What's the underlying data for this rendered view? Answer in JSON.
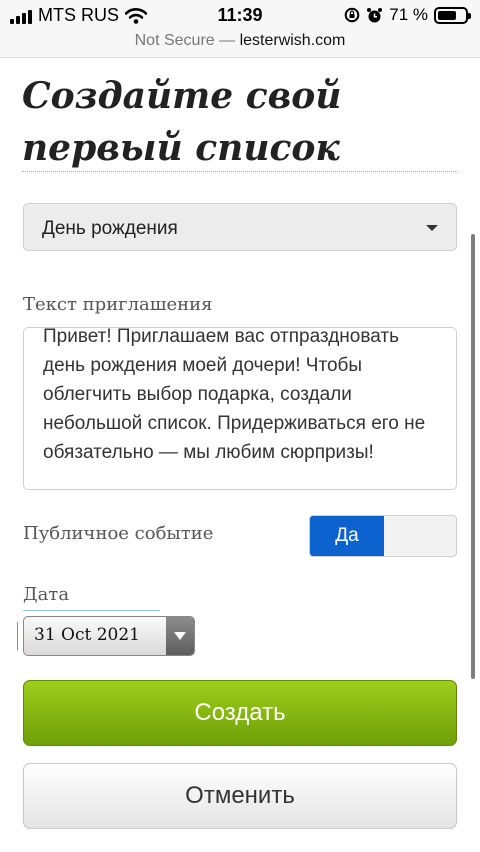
{
  "status_bar": {
    "carrier": "MTS RUS",
    "time": "11:39",
    "battery_text": "71 %",
    "battery_level": 0.71,
    "icons": [
      "signal-icon",
      "wifi-icon",
      "rotation-lock-icon",
      "alarm-icon",
      "battery-icon"
    ]
  },
  "url_bar": {
    "security": "Not Secure — ",
    "domain": "lesterwish.com"
  },
  "page": {
    "title": "Создайте свой первый список"
  },
  "event_type": {
    "selected": "День рождения"
  },
  "invitation": {
    "label": "Текст приглашения",
    "value": "Привет! Приглашаем вас отпраздновать день рождения моей дочери! Чтобы облегчить выбор подарка, создали небольшой список. Придерживаться его не обязательно — мы любим сюрпризы!"
  },
  "public_event": {
    "label": "Публичное событие",
    "on_label": "Да",
    "state": "on"
  },
  "date": {
    "label": "Дата",
    "value": "31 Oct 2021"
  },
  "actions": {
    "create": "Создать",
    "cancel": "Отменить"
  },
  "colors": {
    "accent_blue": "#0c63d0",
    "create_green": "#84b612"
  }
}
